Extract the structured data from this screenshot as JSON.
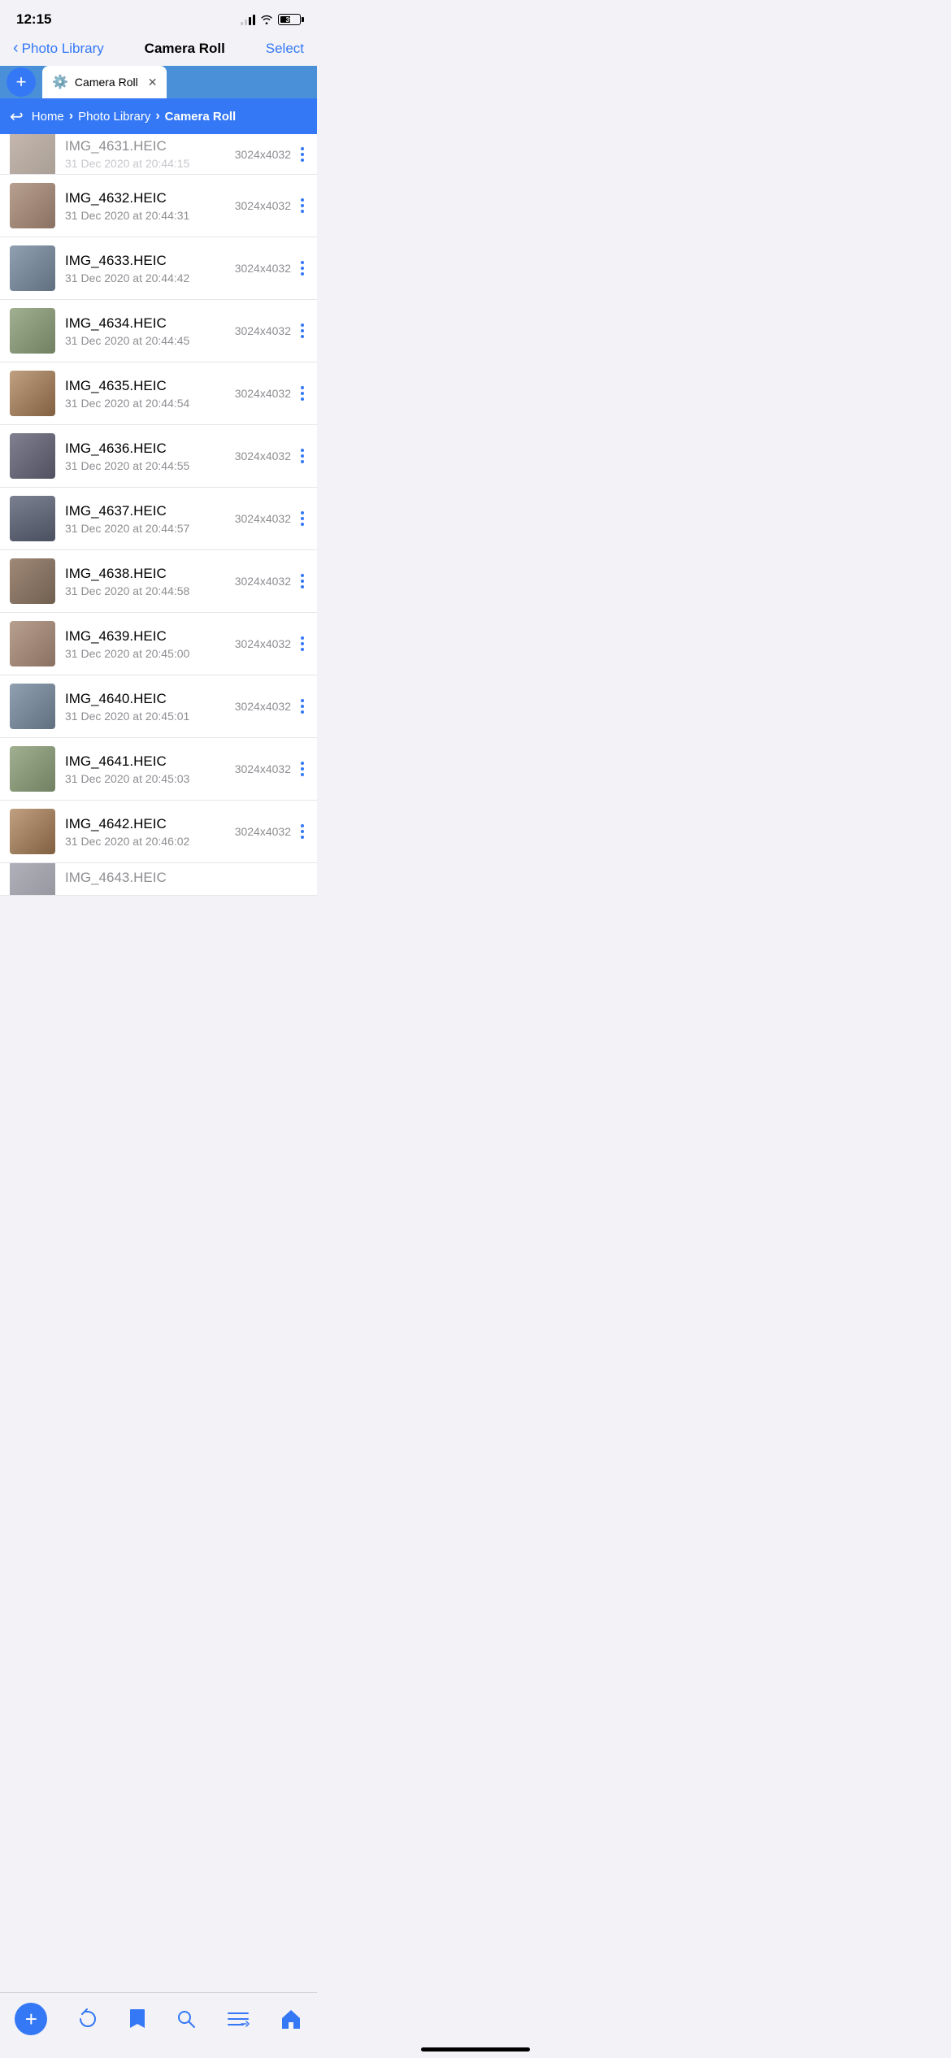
{
  "status": {
    "time": "12:15",
    "battery_pct": "39"
  },
  "nav": {
    "back_label": "Photo Library",
    "title": "Camera Roll",
    "select_label": "Select"
  },
  "tabs": {
    "add_label": "+",
    "active_tab_label": "Camera Roll"
  },
  "breadcrumbs": [
    {
      "label": "Home",
      "active": false
    },
    {
      "label": "Photo Library",
      "active": false
    },
    {
      "label": "Camera Roll",
      "active": true
    }
  ],
  "partial_row": {
    "name": "IMG_4631.HEIC",
    "date": "31 Dec 2020 at 20:44:15",
    "size": "3024x4032"
  },
  "files": [
    {
      "name": "IMG_4632.HEIC",
      "date": "31 Dec 2020 at 20:44:31",
      "size": "3024x4032",
      "thumb": 1
    },
    {
      "name": "IMG_4633.HEIC",
      "date": "31 Dec 2020 at 20:44:42",
      "size": "3024x4032",
      "thumb": 2
    },
    {
      "name": "IMG_4634.HEIC",
      "date": "31 Dec 2020 at 20:44:45",
      "size": "3024x4032",
      "thumb": 3
    },
    {
      "name": "IMG_4635.HEIC",
      "date": "31 Dec 2020 at 20:44:54",
      "size": "3024x4032",
      "thumb": 4
    },
    {
      "name": "IMG_4636.HEIC",
      "date": "31 Dec 2020 at 20:44:55",
      "size": "3024x4032",
      "thumb": 5
    },
    {
      "name": "IMG_4637.HEIC",
      "date": "31 Dec 2020 at 20:44:57",
      "size": "3024x4032",
      "thumb": 6
    },
    {
      "name": "IMG_4638.HEIC",
      "date": "31 Dec 2020 at 20:44:58",
      "size": "3024x4032",
      "thumb": 7
    },
    {
      "name": "IMG_4639.HEIC",
      "date": "31 Dec 2020 at 20:45:00",
      "size": "3024x4032",
      "thumb": 1
    },
    {
      "name": "IMG_4640.HEIC",
      "date": "31 Dec 2020 at 20:45:01",
      "size": "3024x4032",
      "thumb": 2
    },
    {
      "name": "IMG_4641.HEIC",
      "date": "31 Dec 2020 at 20:45:03",
      "size": "3024x4032",
      "thumb": 3
    },
    {
      "name": "IMG_4642.HEIC",
      "date": "31 Dec 2020 at 20:46:02",
      "size": "3024x4032",
      "thumb": 4
    },
    {
      "name": "IMG_4643.HEIC",
      "date": "",
      "size": "",
      "thumb": 5,
      "partial": true
    }
  ],
  "toolbar": {
    "add": "+",
    "refresh": "↻",
    "bookmark": "🔖",
    "search": "🔍",
    "list": "≡",
    "home": "⌂"
  },
  "colors": {
    "accent": "#3478f6",
    "tab_bg": "#4a90d9",
    "breadcrumb_bg": "#3478f6"
  }
}
